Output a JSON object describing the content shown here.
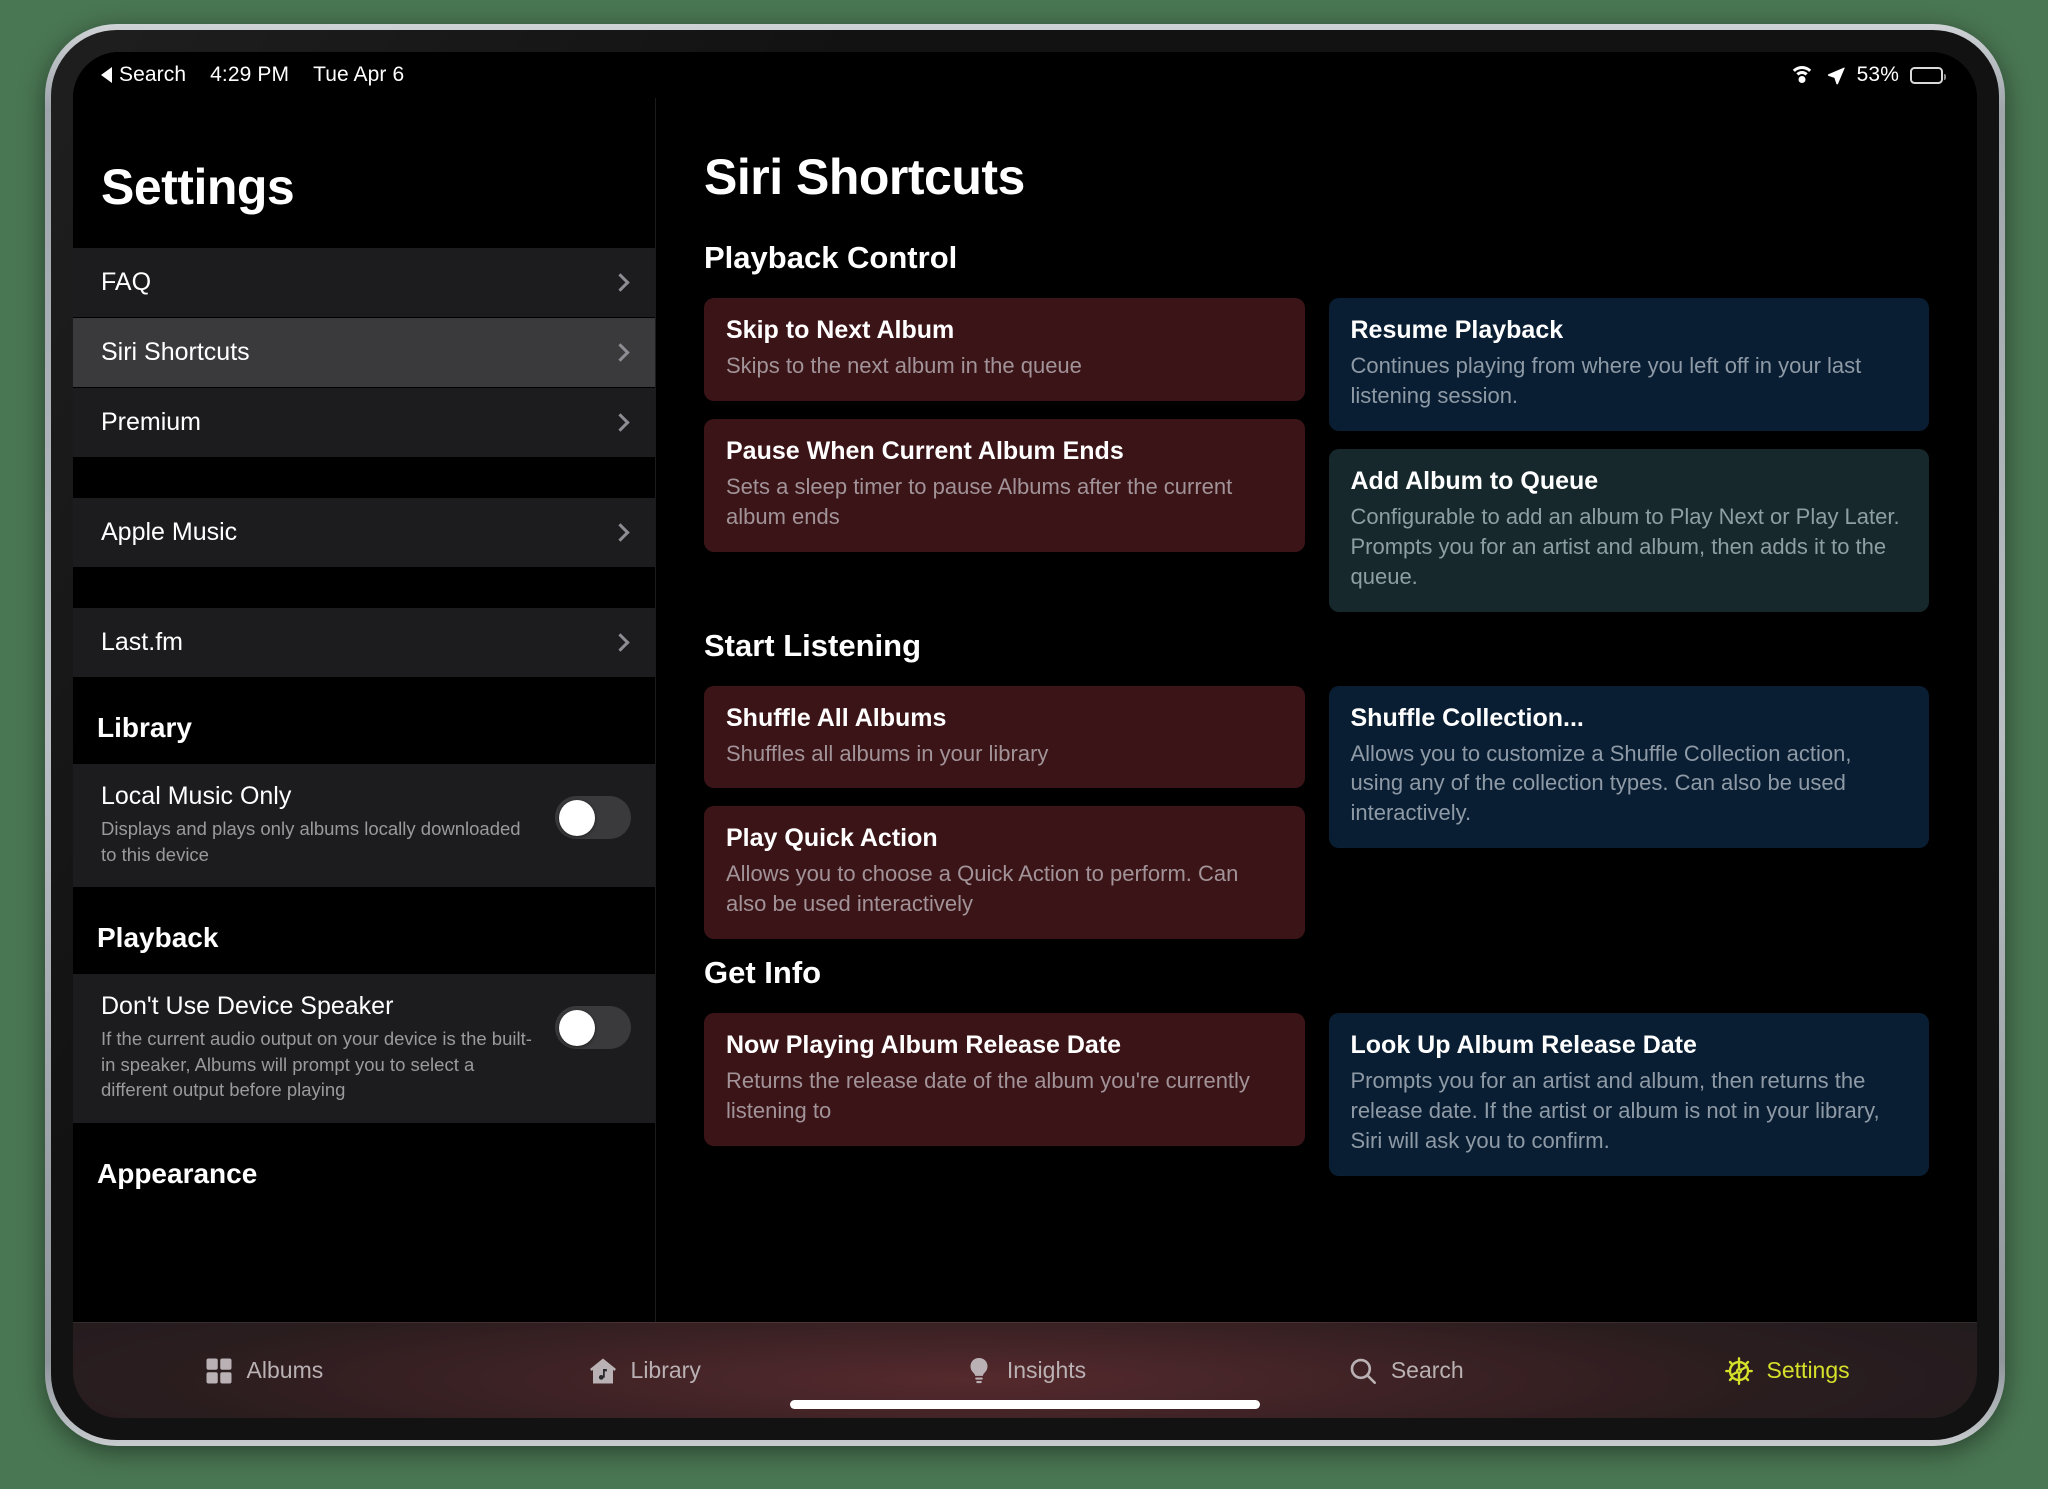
{
  "statusbar": {
    "back_label": "Search",
    "time": "4:29 PM",
    "date": "Tue Apr 6",
    "battery_percent": "53%",
    "icons": [
      "wifi-icon",
      "location-arrow-icon",
      "battery-icon"
    ]
  },
  "sidebar": {
    "title": "Settings",
    "items": [
      {
        "label": "FAQ",
        "type": "link",
        "selected": false
      },
      {
        "label": "Siri Shortcuts",
        "type": "link",
        "selected": true
      },
      {
        "label": "Premium",
        "type": "link",
        "selected": false
      },
      {
        "label": "Apple Music",
        "type": "link",
        "selected": false
      },
      {
        "label": "Last.fm",
        "type": "link",
        "selected": false
      }
    ],
    "library_header": "Library",
    "local_music_only": {
      "title": "Local Music Only",
      "subtitle": "Displays and plays only albums locally downloaded to this device",
      "value": "off"
    },
    "playback_header": "Playback",
    "device_speaker": {
      "title": "Don't Use Device Speaker",
      "subtitle": "If the current audio output on your device is the built-in speaker, Albums will prompt you to select a different output before playing",
      "value": "off"
    },
    "appearance_header": "Appearance"
  },
  "main": {
    "title": "Siri Shortcuts",
    "sections": [
      {
        "header": "Playback Control",
        "left": [
          {
            "title": "Skip to Next Album",
            "subtitle": "Skips to the next album in the queue",
            "color": "red"
          },
          {
            "title": "Pause When Current Album Ends",
            "subtitle": "Sets a sleep timer to pause Albums after the current album ends",
            "color": "red"
          }
        ],
        "right": [
          {
            "title": "Resume Playback",
            "subtitle": "Continues playing from where you left off in your last listening session.",
            "color": "blue"
          },
          {
            "title": "Add Album to Queue",
            "subtitle": "Configurable to add an album to Play Next or Play Later. Prompts you for an artist and album, then adds it to the queue.",
            "color": "teal"
          }
        ]
      },
      {
        "header": "Start Listening",
        "left": [
          {
            "title": "Shuffle All Albums",
            "subtitle": "Shuffles all albums in your library",
            "color": "red"
          },
          {
            "title": "Play Quick Action",
            "subtitle": "Allows you to choose a Quick Action to perform. Can also be used interactively",
            "color": "red"
          }
        ],
        "right": [
          {
            "title": "Shuffle Collection...",
            "subtitle": "Allows you to customize a Shuffle Collection action, using any of the collection types. Can also be used interactively.",
            "color": "blue"
          }
        ]
      },
      {
        "header": "Get Info",
        "left": [
          {
            "title": "Now Playing Album Release Date",
            "subtitle": "Returns the release date of the album you're currently listening to",
            "color": "red"
          }
        ],
        "right": [
          {
            "title": "Look Up Album Release Date",
            "subtitle": "Prompts you for an artist and album, then returns the release date. If the artist or album is not in your library, Siri will ask you to confirm.",
            "color": "blue"
          }
        ]
      }
    ]
  },
  "tabbar": {
    "items": [
      {
        "label": "Albums",
        "icon": "grid-icon",
        "active": false
      },
      {
        "label": "Library",
        "icon": "house-note-icon",
        "active": false
      },
      {
        "label": "Insights",
        "icon": "lightbulb-icon",
        "active": false
      },
      {
        "label": "Search",
        "icon": "search-icon",
        "active": false
      },
      {
        "label": "Settings",
        "icon": "gear-icon",
        "active": true
      }
    ],
    "active_color": "#d4e02a",
    "inactive_color": "#b9b1b3"
  }
}
